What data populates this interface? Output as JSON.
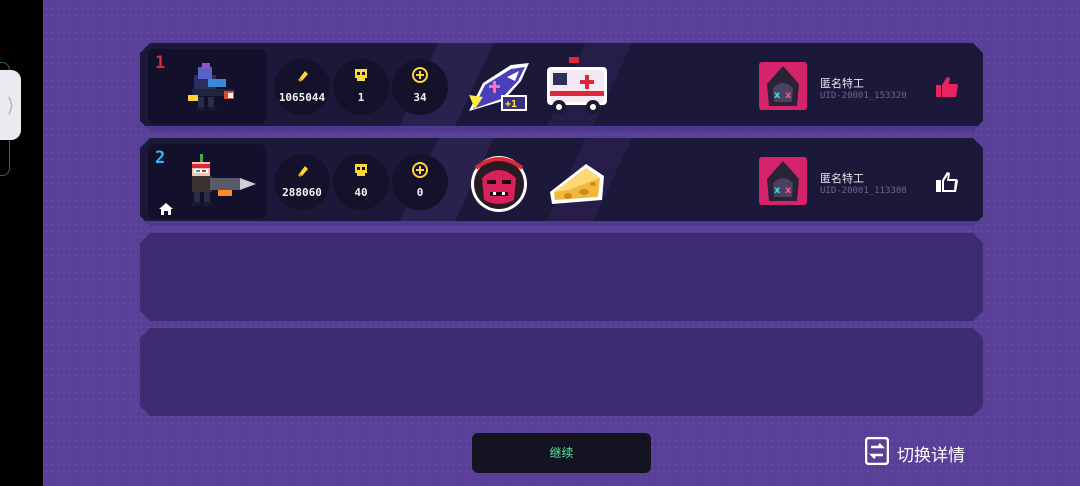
{
  "colors": {
    "like_active": "#e8245f",
    "like_inactive": "#ffffff",
    "continue_text": "#5fe3a2"
  },
  "players": [
    {
      "rank": "1",
      "rank_color": "#e0263a",
      "bullets": "1065044",
      "kills": "1",
      "coins": "34",
      "items": [
        "shark-plus-one-icon",
        "ambulance-icon"
      ],
      "agent_name": "匿名特工",
      "uid": "UID-20001_153320",
      "liked": true,
      "is_host": false
    },
    {
      "rank": "2",
      "rank_color": "#37b8ee",
      "bullets": "288060",
      "kills": "40",
      "coins": "0",
      "items": [
        "demon-face-icon",
        "cheese-icon"
      ],
      "agent_name": "匿名特工",
      "uid": "UID-20001_113308",
      "liked": false,
      "is_host": true
    }
  ],
  "buttons": {
    "continue": "继续",
    "switch_details": "切换详情"
  },
  "side_handle": "⟩"
}
